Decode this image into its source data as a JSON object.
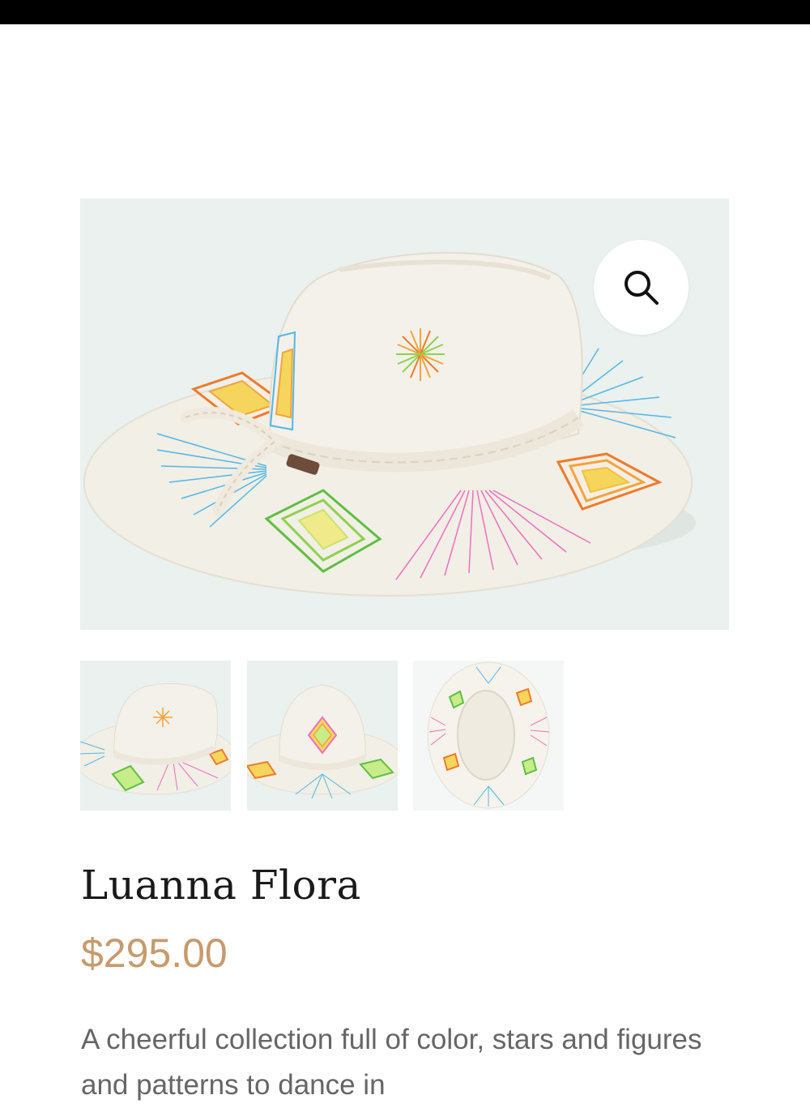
{
  "product": {
    "title": "Luanna Flora",
    "price": "$295.00",
    "description": "A cheerful  collection full of color, stars and figures and patterns to dance in"
  },
  "gallery": {
    "zoom_icon": "magnifier-icon",
    "thumbnails": [
      {
        "view": "side"
      },
      {
        "view": "front"
      },
      {
        "view": "top"
      }
    ]
  },
  "colors": {
    "price": "#c79a6d",
    "title": "#1a1a1a",
    "text": "#666666",
    "background": "#eaf1ee"
  }
}
